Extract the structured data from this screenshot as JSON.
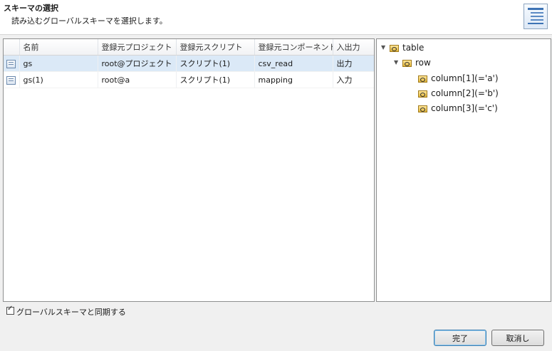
{
  "header": {
    "title": "スキーマの選択",
    "subtitle": "読み込むグローバルスキーマを選択します。"
  },
  "table": {
    "columns": [
      "名前",
      "登録元プロジェクト",
      "登録元スクリプト",
      "登録元コンポーネント",
      "入出力"
    ],
    "rows": [
      {
        "name": "gs",
        "project": "root@プロジェクト",
        "script": "スクリプト(1)",
        "component": "csv_read",
        "io": "出力",
        "selected": true
      },
      {
        "name": "gs(1)",
        "project": "root@a",
        "script": "スクリプト(1)",
        "component": "mapping",
        "io": "入力",
        "selected": false
      }
    ]
  },
  "tree": {
    "root": "table",
    "child": "row",
    "columns": [
      "column[1](='a')",
      "column[2](='b')",
      "column[3](='c')"
    ]
  },
  "footer": {
    "sync_label": "グローバルスキーマと同期する",
    "sync_checked": true,
    "ok_label": "完了",
    "cancel_label": "取消し"
  }
}
